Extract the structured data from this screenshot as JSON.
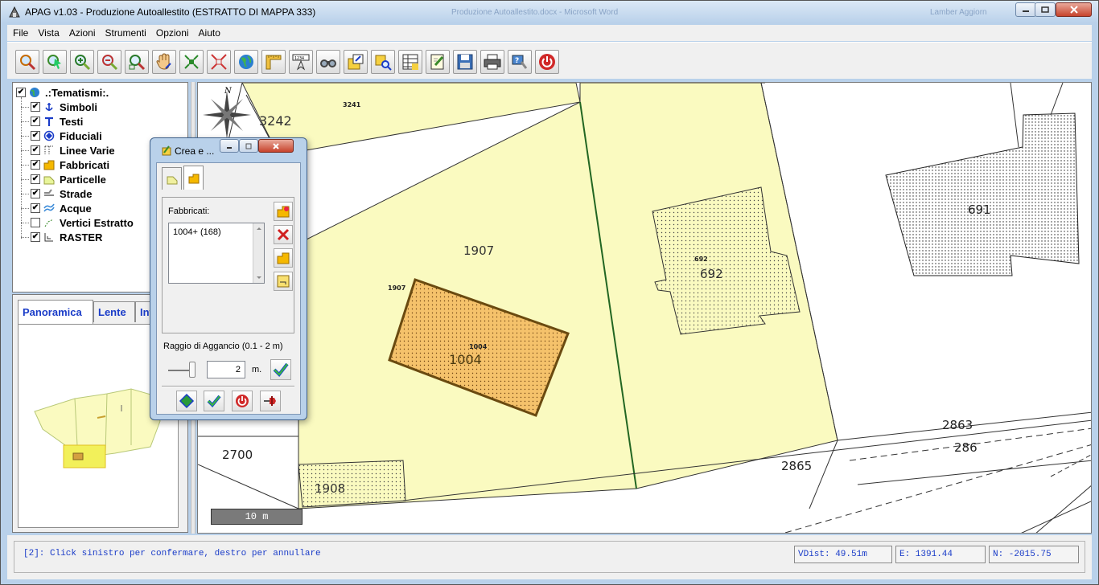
{
  "window": {
    "title": "APAG v1.03 - Produzione Autoallestito (ESTRATTO DI MAPPA 333)",
    "ghost_title": "Produzione Autoallestito.docx - Microsoft Word",
    "ghost_right": "Lamber Aggiorn"
  },
  "menu": [
    "File",
    "Vista",
    "Azioni",
    "Strumenti",
    "Opzioni",
    "Aiuto"
  ],
  "toolbar": {
    "buttons": [
      "zoom-extents",
      "pointer-select",
      "zoom-in",
      "zoom-out",
      "zoom-window",
      "pan-hand",
      "shrink",
      "expand",
      "globe",
      "ruler",
      "coordinates",
      "binoculars",
      "layer-edit",
      "layer-search",
      "table",
      "document-edit",
      "save",
      "print",
      "help",
      "power"
    ]
  },
  "tree": {
    "root": ".:Tematismi:.",
    "items": [
      {
        "label": "Simboli",
        "checked": true,
        "icon": "anchor-icon"
      },
      {
        "label": "Testi",
        "checked": true,
        "icon": "text-icon"
      },
      {
        "label": "Fiduciali",
        "checked": true,
        "icon": "target-icon"
      },
      {
        "label": "Linee Varie",
        "checked": true,
        "icon": "dotted-lines-icon"
      },
      {
        "label": "Fabbricati",
        "checked": true,
        "icon": "building-icon"
      },
      {
        "label": "Particelle",
        "checked": true,
        "icon": "parcel-icon"
      },
      {
        "label": "Strade",
        "checked": true,
        "icon": "road-icon"
      },
      {
        "label": "Acque",
        "checked": true,
        "icon": "water-icon"
      },
      {
        "label": "Vertici Estratto",
        "checked": false,
        "icon": "vertex-icon"
      },
      {
        "label": "RASTER",
        "checked": true,
        "icon": "raster-icon"
      }
    ]
  },
  "panorama_tabs": [
    "Panoramica",
    "Lente",
    "Inf"
  ],
  "map_labels": {
    "north": "N",
    "p3242": "3242",
    "p3241": "3241",
    "p1907": "1907",
    "p1907_small": "1907",
    "p1004": "1004",
    "p1004_small": "1004",
    "p692": "692",
    "p692_small": "692",
    "p691": "691",
    "p1908": "1908",
    "p2700": "2700",
    "p2865": "2865",
    "p2863": "2863",
    "p286x": "286"
  },
  "scalebar": "10 m",
  "status": {
    "message": "[2]: Click sinistro per confermare, destro per annullare",
    "vdist": "VDist: 49.51m",
    "e": "E: 1391.44",
    "n": "N: -2015.75"
  },
  "dialog": {
    "title": "Crea e ...",
    "section_label": "Fabbricati:",
    "list_items": [
      "1004+ (168)"
    ],
    "snap_label": "Raggio di Aggancio (0.1 - 2 m)",
    "snap_value": "2",
    "snap_unit": "m."
  },
  "colors": {
    "parcel_fill": "#fafac0",
    "building_selected": "#f5c26b",
    "accent_blue": "#1a3cc8"
  }
}
